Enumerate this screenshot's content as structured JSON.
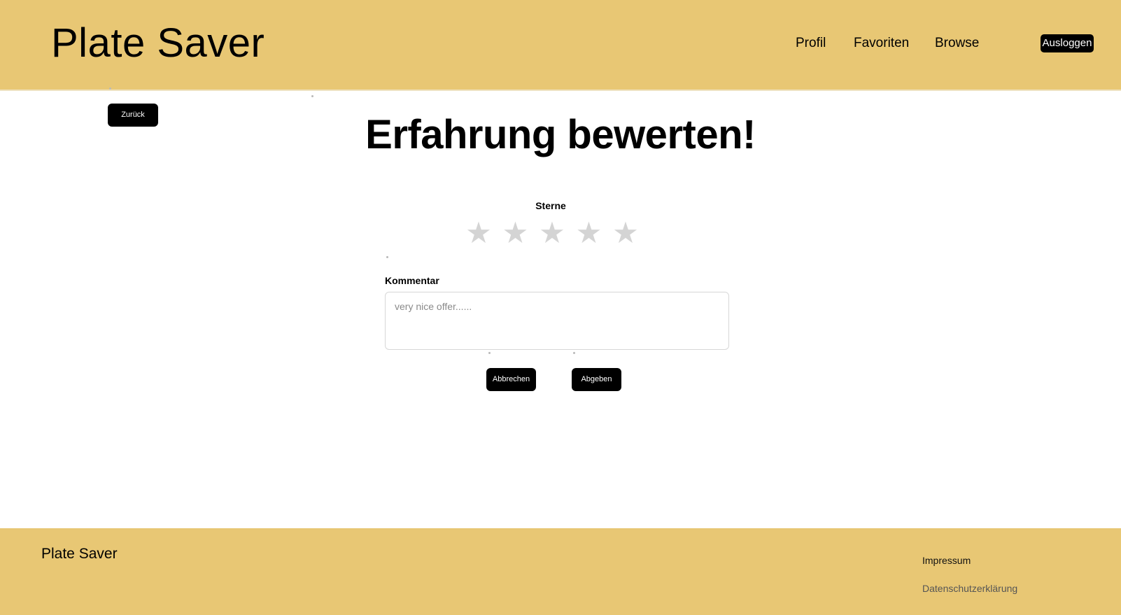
{
  "header": {
    "brand": "Plate Saver",
    "nav": [
      {
        "label": "Profil"
      },
      {
        "label": "Favoriten"
      },
      {
        "label": "Browse"
      }
    ],
    "logout_label": "Ausloggen"
  },
  "main": {
    "back_label": "Zurück",
    "title": "Erfahrung bewerten!",
    "stars": {
      "label": "Sterne",
      "glyph": "★",
      "count": 5,
      "selected": 0,
      "empty_color": "#d4d4d4"
    },
    "comment": {
      "label": "Kommentar",
      "value": "",
      "placeholder": "very nice offer......"
    },
    "cancel_label": "Abbrechen",
    "submit_label": "Abgeben"
  },
  "footer": {
    "brand": "Plate Saver",
    "links": [
      {
        "label": "Impressum"
      },
      {
        "label": "Datenschutzerklärung"
      }
    ]
  },
  "theme": {
    "accent": "#e8c774",
    "button": "#000000"
  }
}
